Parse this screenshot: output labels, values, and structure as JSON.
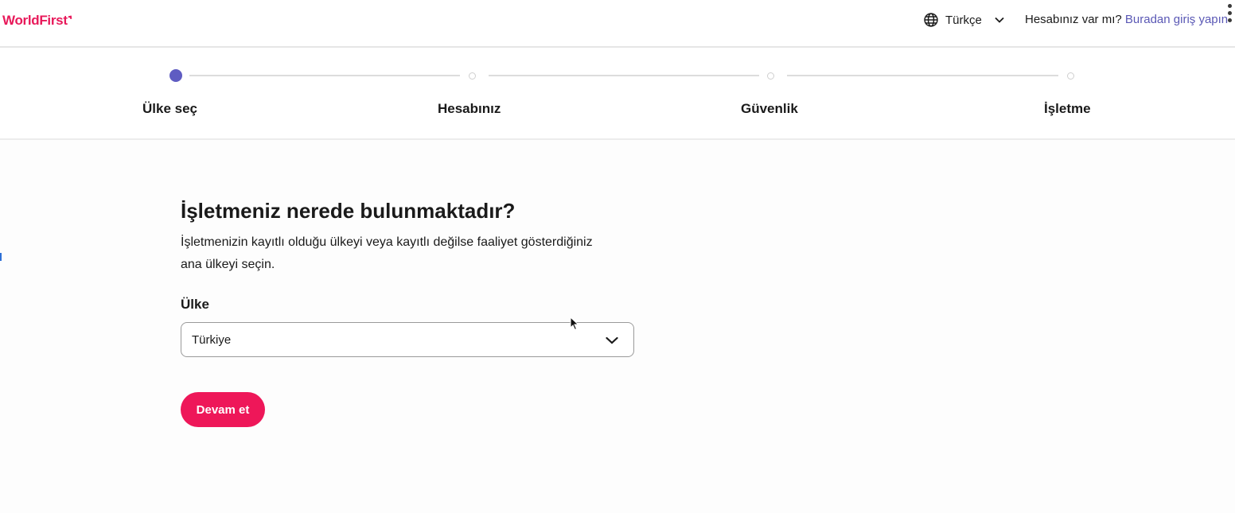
{
  "header": {
    "logo_text": "WorldFirst",
    "language": {
      "icon": "globe-icon",
      "label": "Türkçe",
      "chevron_icon": "chevron-down-icon"
    },
    "login_prompt": "Hesabınız var mı?",
    "login_link": "Buradan giriş yapın",
    "menu_icon": "kebab-menu-icon"
  },
  "stepper": {
    "active_index": 0,
    "steps": [
      {
        "label": "Ülke seç"
      },
      {
        "label": "Hesabınız"
      },
      {
        "label": "Güvenlik"
      },
      {
        "label": "İşletme"
      }
    ]
  },
  "main": {
    "title": "İşletmeniz nerede bulunmaktadır?",
    "description": "İşletmenizin kayıtlı olduğu ülkeyi veya kayıtlı değilse faaliyet gösterdiğiniz ana ülkeyi seçin.",
    "country_field": {
      "label": "Ülke",
      "selected": "Türkiye",
      "chevron_icon": "chevron-down-icon"
    },
    "continue_label": "Devam et"
  },
  "colors": {
    "brand": "#e8195a",
    "button": "#ee1759",
    "step_active": "#5f5cc2",
    "link": "#5a58b5"
  }
}
